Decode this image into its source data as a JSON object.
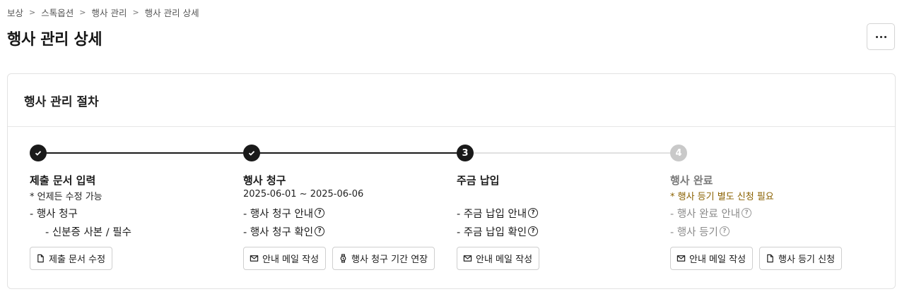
{
  "breadcrumb": [
    "보상",
    "스톡옵션",
    "행사 관리",
    "행사 관리 상세"
  ],
  "page_title": "행사 관리 상세",
  "card": {
    "title": "행사 관리 절차",
    "steps": [
      {
        "state": "done",
        "number": "1",
        "title": "제출 문서 입력",
        "subtitle": "* 언제든 수정 가능",
        "items": [
          {
            "text": "- 행사 청구",
            "indent": false,
            "help": false
          },
          {
            "text": "- 신분증 사본 / 필수",
            "indent": true,
            "help": false
          }
        ],
        "buttons": [
          {
            "label": "제출 문서 수정",
            "icon": "document-icon",
            "name": "edit-submission-docs-button"
          }
        ]
      },
      {
        "state": "done",
        "number": "2",
        "title": "행사 청구",
        "subtitle": "2025-06-01 ~ 2025-06-06",
        "items": [
          {
            "text": "- 행사 청구 안내",
            "indent": false,
            "help": true
          },
          {
            "text": "- 행사 청구 확인",
            "indent": false,
            "help": true
          }
        ],
        "buttons": [
          {
            "label": "안내 메일 작성",
            "icon": "mail-icon",
            "name": "write-guide-mail-button"
          },
          {
            "label": "행사 청구 기간 연장",
            "icon": "watch-icon",
            "name": "extend-claim-period-button"
          }
        ]
      },
      {
        "state": "current",
        "number": "3",
        "title": "주금 납입",
        "subtitle": "",
        "items": [
          {
            "text": "- 주금 납입 안내",
            "indent": false,
            "help": true
          },
          {
            "text": "- 주금 납입 확인",
            "indent": false,
            "help": true
          }
        ],
        "buttons": [
          {
            "label": "안내 메일 작성",
            "icon": "mail-icon",
            "name": "write-payment-mail-button"
          }
        ]
      },
      {
        "state": "pending",
        "number": "4",
        "title": "행사 완료",
        "subtitle": "* 행사 등기 별도 신청 필요",
        "items": [
          {
            "text": "- 행사 완료 안내",
            "indent": false,
            "help": true
          },
          {
            "text": "- 행사 등기",
            "indent": false,
            "help": true
          }
        ],
        "buttons": [
          {
            "label": "안내 메일 작성",
            "icon": "mail-icon",
            "name": "write-completion-mail-button"
          },
          {
            "label": "행사 등기 신청",
            "icon": "document-icon",
            "name": "apply-registration-button"
          }
        ]
      }
    ]
  },
  "colors": {
    "done": "#1a1a1a",
    "current": "#1a1a1a",
    "pending": "#c9c9c9",
    "line_done": "#1a1a1a",
    "line_pending": "#e0e0e0",
    "warning_text": "#8a6100"
  }
}
